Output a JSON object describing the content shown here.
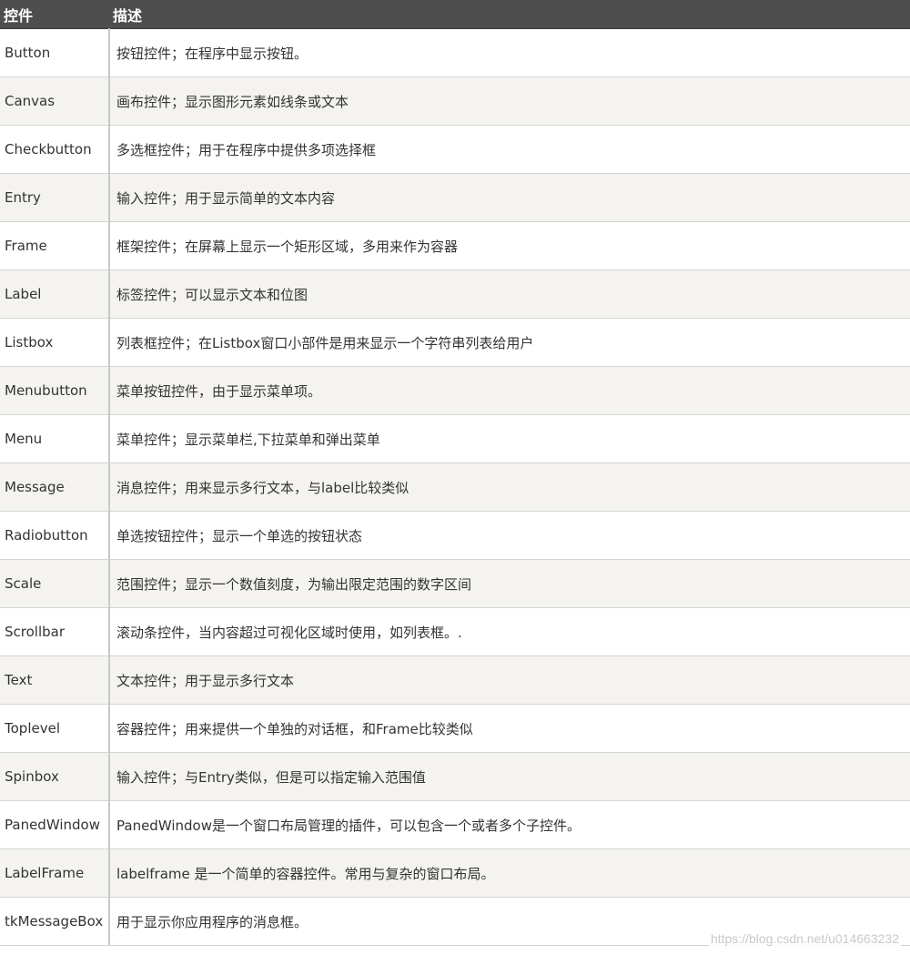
{
  "header": {
    "col_name": "控件",
    "col_desc": "描述"
  },
  "rows": [
    {
      "name": "Button",
      "desc": "按钮控件；在程序中显示按钮。"
    },
    {
      "name": "Canvas",
      "desc": "画布控件；显示图形元素如线条或文本"
    },
    {
      "name": "Checkbutton",
      "desc": "多选框控件；用于在程序中提供多项选择框"
    },
    {
      "name": "Entry",
      "desc": "输入控件；用于显示简单的文本内容"
    },
    {
      "name": "Frame",
      "desc": "框架控件；在屏幕上显示一个矩形区域，多用来作为容器"
    },
    {
      "name": "Label",
      "desc": "标签控件；可以显示文本和位图"
    },
    {
      "name": "Listbox",
      "desc": "列表框控件；在Listbox窗口小部件是用来显示一个字符串列表给用户"
    },
    {
      "name": "Menubutton",
      "desc": "菜单按钮控件，由于显示菜单项。"
    },
    {
      "name": "Menu",
      "desc": "菜单控件；显示菜单栏,下拉菜单和弹出菜单"
    },
    {
      "name": "Message",
      "desc": "消息控件；用来显示多行文本，与label比较类似"
    },
    {
      "name": "Radiobutton",
      "desc": "单选按钮控件；显示一个单选的按钮状态"
    },
    {
      "name": "Scale",
      "desc": "范围控件；显示一个数值刻度，为输出限定范围的数字区间"
    },
    {
      "name": "Scrollbar",
      "desc": "滚动条控件，当内容超过可视化区域时使用，如列表框。."
    },
    {
      "name": "Text",
      "desc": "文本控件；用于显示多行文本"
    },
    {
      "name": "Toplevel",
      "desc": "容器控件；用来提供一个单独的对话框，和Frame比较类似"
    },
    {
      "name": "Spinbox",
      "desc": "输入控件；与Entry类似，但是可以指定输入范围值"
    },
    {
      "name": "PanedWindow",
      "desc": "PanedWindow是一个窗口布局管理的插件，可以包含一个或者多个子控件。"
    },
    {
      "name": "LabelFrame",
      "desc": "labelframe 是一个简单的容器控件。常用与复杂的窗口布局。"
    },
    {
      "name": "tkMessageBox",
      "desc": "用于显示你应用程序的消息框。"
    }
  ],
  "watermark": "https://blog.csdn.net/u014663232",
  "colors": {
    "header_bg": "#4e4e4e",
    "row_alt_bg": "#f4f3ef",
    "text": "#333333"
  }
}
